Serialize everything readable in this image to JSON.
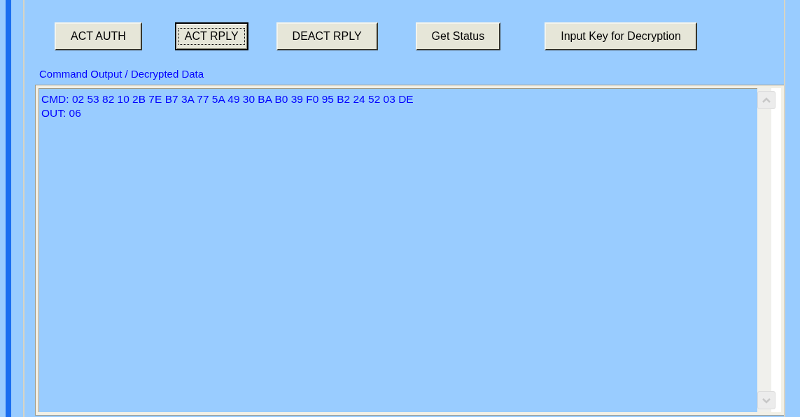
{
  "buttons": [
    {
      "label": "ACT AUTH",
      "focused": false
    },
    {
      "label": "ACT RPLY",
      "focused": true
    },
    {
      "label": "DEACT RPLY",
      "focused": false
    },
    {
      "label": "Get Status",
      "focused": false
    },
    {
      "label": "Input Key for Decryption",
      "focused": false
    }
  ],
  "output": {
    "label": "Command Output / Decrypted Data",
    "lines": [
      "CMD: 02 53 82 10 2B 7E B7 3A 77 5A 49 30 BA B0 39 F0 95 B2 24 52 03 DE",
      "OUT: 06"
    ]
  }
}
